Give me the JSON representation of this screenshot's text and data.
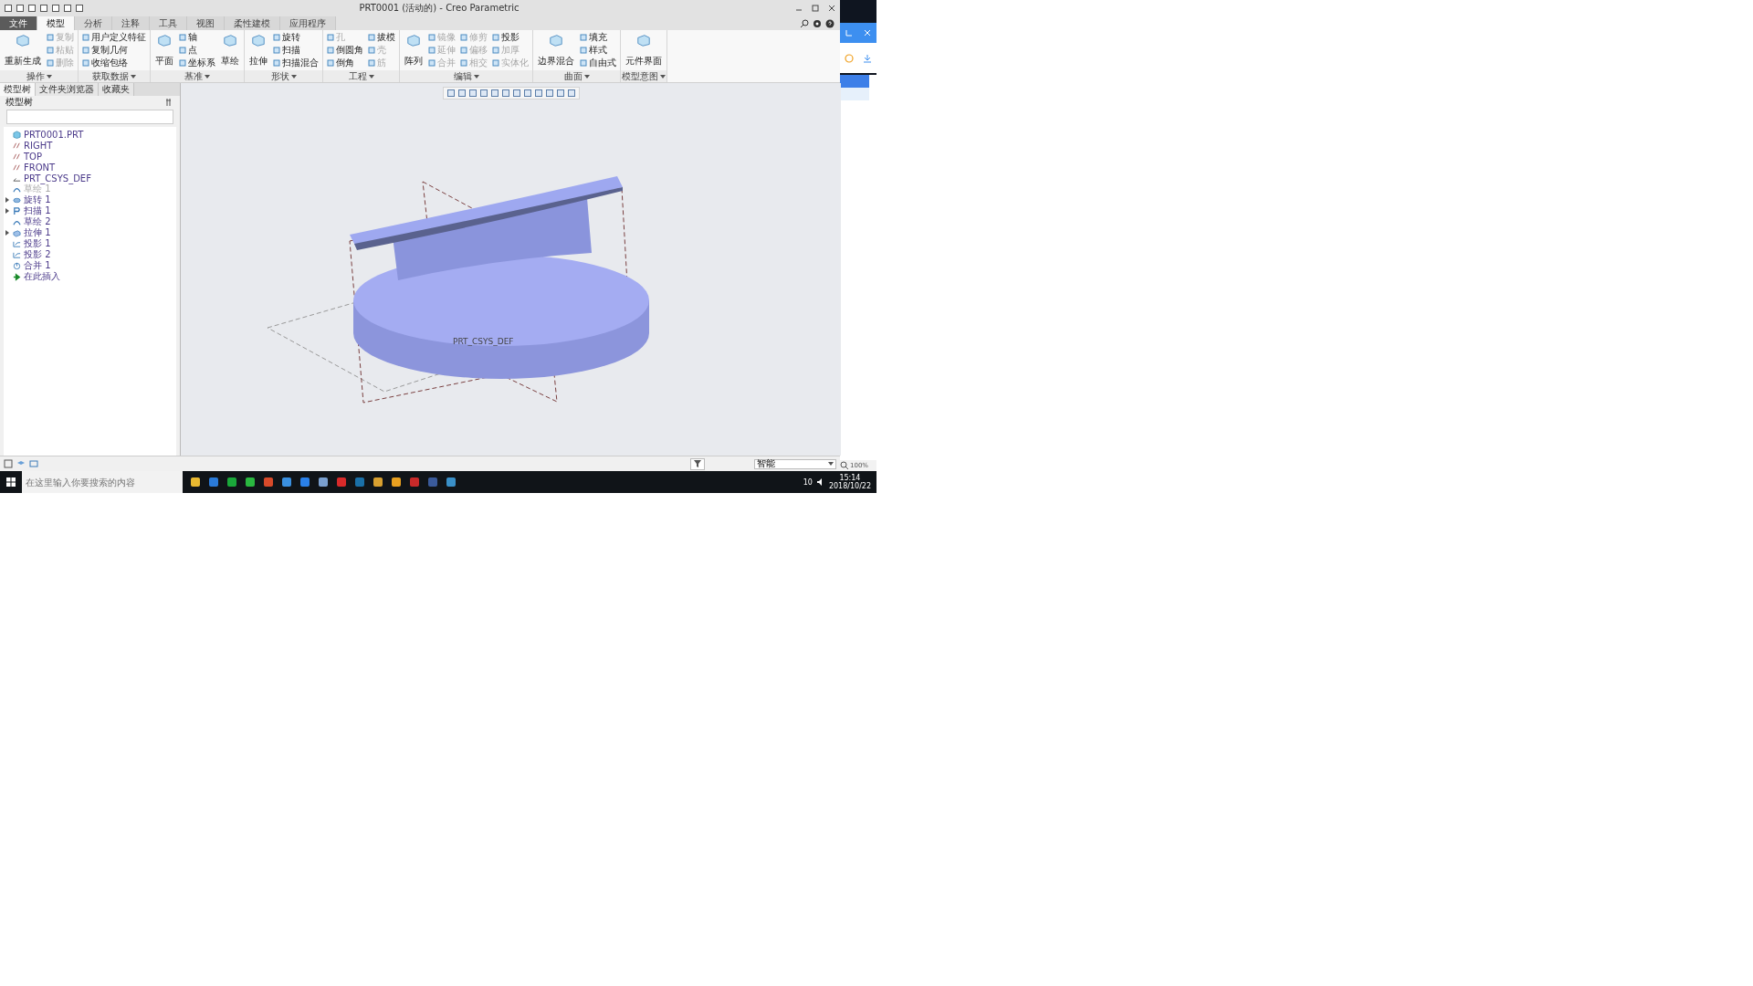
{
  "window": {
    "title": "PRT0001 (活动的) - Creo Parametric"
  },
  "ribbon_tabs": [
    {
      "label": "文件",
      "selected": false,
      "kind": "file"
    },
    {
      "label": "模型",
      "selected": true,
      "kind": "tab"
    },
    {
      "label": "分析",
      "selected": false,
      "kind": "tab"
    },
    {
      "label": "注释",
      "selected": false,
      "kind": "tab"
    },
    {
      "label": "工具",
      "selected": false,
      "kind": "tab"
    },
    {
      "label": "视图",
      "selected": false,
      "kind": "tab"
    },
    {
      "label": "柔性建模",
      "selected": false,
      "kind": "tab"
    },
    {
      "label": "应用程序",
      "selected": false,
      "kind": "tab"
    }
  ],
  "ribbon_groups": [
    {
      "label": "操作",
      "big": [
        {
          "label": "重新生成",
          "disabled": false
        }
      ],
      "columns": [
        [
          {
            "label": "复制",
            "disabled": true
          },
          {
            "label": "粘贴",
            "disabled": true
          },
          {
            "label": "删除",
            "disabled": true
          }
        ]
      ]
    },
    {
      "label": "获取数据",
      "columns": [
        [
          {
            "label": "用户定义特征",
            "disabled": false
          },
          {
            "label": "复制几何",
            "disabled": false
          },
          {
            "label": "收缩包络",
            "disabled": false
          }
        ]
      ]
    },
    {
      "label": "基准",
      "big": [
        {
          "label": "平面",
          "disabled": false
        }
      ],
      "columns": [
        [
          {
            "label": "轴",
            "disabled": false
          },
          {
            "label": "点",
            "disabled": false
          },
          {
            "label": "坐标系",
            "disabled": false
          }
        ]
      ],
      "big_after": [
        {
          "label": "草绘",
          "disabled": false
        }
      ]
    },
    {
      "label": "形状",
      "big": [
        {
          "label": "拉伸",
          "disabled": false
        }
      ],
      "columns": [
        [
          {
            "label": "旋转",
            "disabled": false
          },
          {
            "label": "扫描",
            "disabled": false
          },
          {
            "label": "扫描混合",
            "disabled": false
          }
        ]
      ]
    },
    {
      "label": "工程",
      "columns": [
        [
          {
            "label": "孔",
            "disabled": true
          },
          {
            "label": "倒圆角",
            "disabled": false
          },
          {
            "label": "倒角",
            "disabled": false
          }
        ],
        [
          {
            "label": "拔模",
            "disabled": false
          },
          {
            "label": "壳",
            "disabled": true
          },
          {
            "label": "筋",
            "disabled": true
          }
        ]
      ]
    },
    {
      "label": "编辑",
      "big": [
        {
          "label": "阵列",
          "disabled": false
        }
      ],
      "columns": [
        [
          {
            "label": "镜像",
            "disabled": true
          },
          {
            "label": "延伸",
            "disabled": true
          },
          {
            "label": "合并",
            "disabled": true
          }
        ],
        [
          {
            "label": "修剪",
            "disabled": true
          },
          {
            "label": "偏移",
            "disabled": true
          },
          {
            "label": "相交",
            "disabled": true
          }
        ],
        [
          {
            "label": "投影",
            "disabled": false
          },
          {
            "label": "加厚",
            "disabled": true
          },
          {
            "label": "实体化",
            "disabled": true
          }
        ]
      ]
    },
    {
      "label": "曲面",
      "big": [
        {
          "label": "边界混合",
          "disabled": false
        }
      ],
      "columns": [
        [
          {
            "label": "填充",
            "disabled": false
          },
          {
            "label": "样式",
            "disabled": false
          },
          {
            "label": "自由式",
            "disabled": false
          }
        ]
      ]
    },
    {
      "label": "模型意图",
      "big": [
        {
          "label": "元件界面",
          "disabled": false
        }
      ]
    }
  ],
  "navigator": {
    "tabs": [
      {
        "label": "模型树",
        "selected": true
      },
      {
        "label": "文件夹浏览器",
        "selected": false
      },
      {
        "label": "收藏夹",
        "selected": false
      }
    ],
    "header": "模型树"
  },
  "model_tree": [
    {
      "label": "PRT0001.PRT",
      "kind": "part",
      "hidden": false
    },
    {
      "label": "RIGHT",
      "kind": "datum_plane",
      "hidden": false
    },
    {
      "label": "TOP",
      "kind": "datum_plane",
      "hidden": false
    },
    {
      "label": "FRONT",
      "kind": "datum_plane",
      "hidden": false
    },
    {
      "label": "PRT_CSYS_DEF",
      "kind": "csys",
      "hidden": false
    },
    {
      "label": "草绘 1",
      "kind": "sketch",
      "hidden": true
    },
    {
      "label": "旋转 1",
      "kind": "revolve",
      "expanded": false,
      "hidden": false
    },
    {
      "label": "扫描 1",
      "kind": "sweep",
      "expanded": false,
      "hidden": false
    },
    {
      "label": "草绘 2",
      "kind": "sketch",
      "hidden": false
    },
    {
      "label": "拉伸 1",
      "kind": "extrude",
      "expanded": false,
      "hidden": false
    },
    {
      "label": "投影 1",
      "kind": "projection",
      "hidden": false
    },
    {
      "label": "投影 2",
      "kind": "projection",
      "hidden": false
    },
    {
      "label": "合并 1",
      "kind": "merge",
      "hidden": false
    },
    {
      "label": "在此插入",
      "kind": "insert",
      "hidden": false
    }
  ],
  "viewport": {
    "csys_label": "PRT_CSYS_DEF"
  },
  "status_bar": {
    "filter_value": "智能"
  },
  "side_panel": {
    "zoom": "100%"
  },
  "taskbar": {
    "search_placeholder": "在这里输入你要搜索的内容",
    "time": "15:14",
    "date": "2018/10/22",
    "tray_text": "10"
  }
}
